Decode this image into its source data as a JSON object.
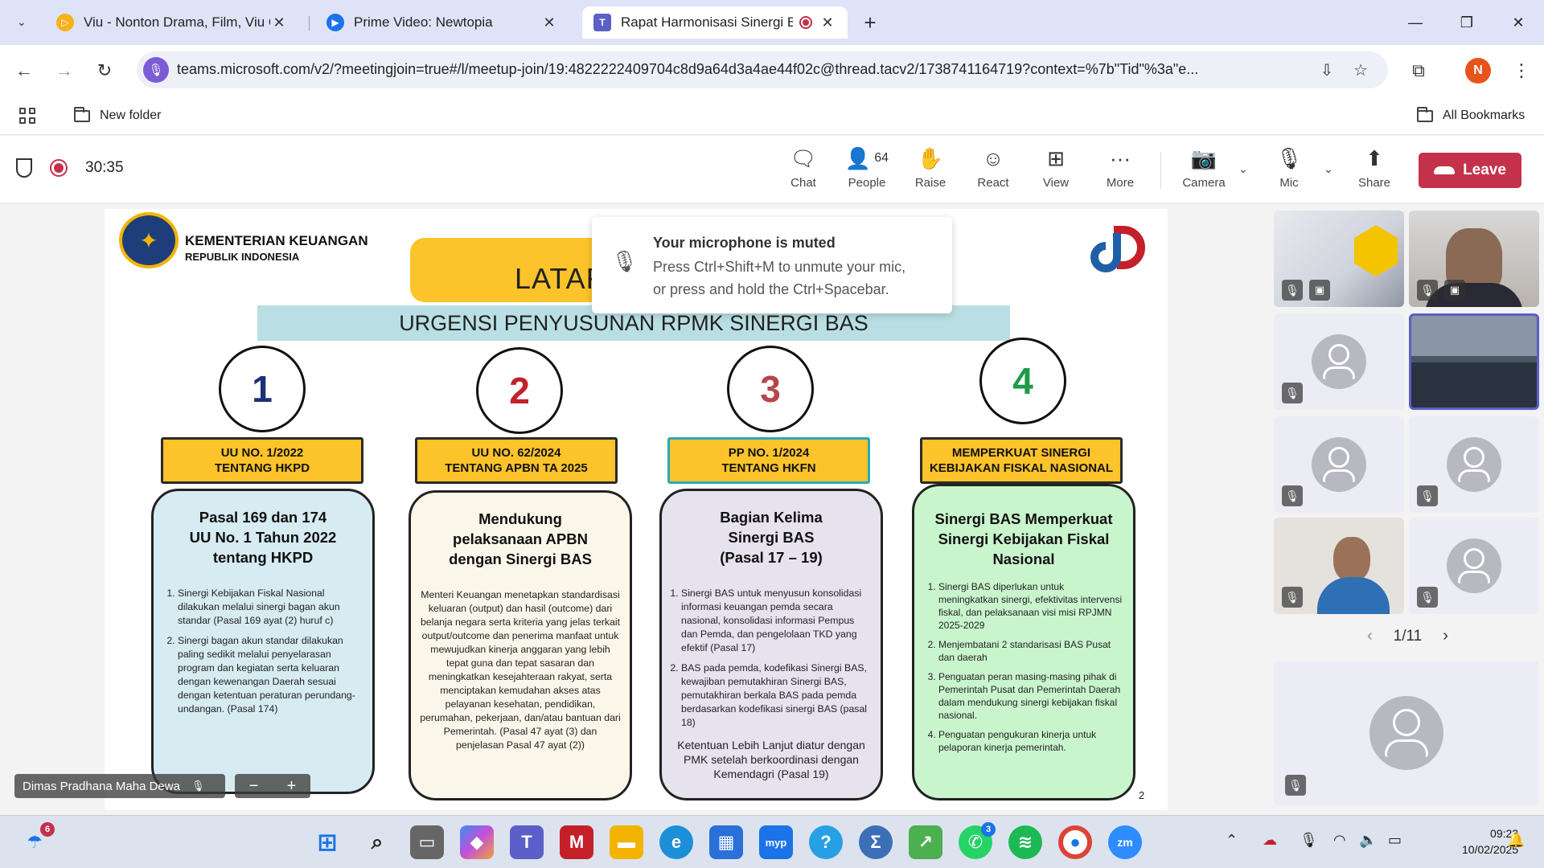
{
  "browser": {
    "tabs": [
      {
        "title": "Viu - Nonton Drama, Film, Viu O",
        "icon": "viu-icon",
        "color": "#f5b21a"
      },
      {
        "title": "Prime Video: Newtopia",
        "icon": "prime-video-icon",
        "color": "#1a73e8"
      },
      {
        "title": "Rapat Harmonisasi Sinergi B",
        "icon": "teams-icon",
        "color": "#5b5fc7"
      }
    ],
    "url": "teams.microsoft.com/v2/?meetingjoin=true#/l/meetup-join/19:4822222409704c8d9a64d3a4ae44f02c@thread.tacv2/1738741164719?context=%7b\"Tid\"%3a\"e...",
    "bookmarks": {
      "folder": "New folder",
      "all": "All Bookmarks"
    },
    "profile_initial": "N"
  },
  "teams": {
    "timer": "30:35",
    "buttons": {
      "chat": "Chat",
      "people": "People",
      "people_count": "64",
      "raise": "Raise",
      "react": "React",
      "view": "View",
      "more": "More",
      "camera": "Camera",
      "mic": "Mic",
      "share": "Share",
      "leave": "Leave"
    },
    "toast": {
      "title": "Your microphone is muted",
      "line1": "Press Ctrl+Shift+M to unmute your mic,",
      "line2": "or press and hold the Ctrl+Spacebar."
    },
    "presenter": "Dimas Pradhana Maha Dewa",
    "zoom": {
      "minus": "−",
      "plus": "+"
    },
    "pager": "1/11"
  },
  "slide": {
    "org_line1": "KEMENTERIAN KEUANGAN",
    "org_line2": "REPUBLIK INDONESIA",
    "header": "LATAR",
    "subheader": "URGENSI PENYUSUNAN RPMK SINERGI BAS",
    "page": "2",
    "columns": [
      {
        "num": "1",
        "num_color": "#1d2f7a",
        "label_bg": "#fcc32a",
        "card_bg": "#d6ebf2",
        "label1": "UU NO. 1/2022",
        "label2": "TENTANG HKPD",
        "title1": "Pasal 169 dan 174",
        "title2": "UU No. 1 Tahun 2022",
        "title3": "tentang HKPD",
        "items": [
          "Sinergi Kebijakan Fiskal Nasional dilakukan melalui sinergi bagan akun standar (Pasal 169 ayat (2) huruf c)",
          "Sinergi bagan akun standar dilakukan paling sedikit melalui penyelarasan program dan kegiatan serta keluaran dengan kewenangan Daerah sesuai dengan ketentuan peraturan perundang-undangan. (Pasal 174)"
        ]
      },
      {
        "num": "2",
        "num_color": "#c4202a",
        "label_bg": "#fcc32a",
        "card_bg": "#fbf6ea",
        "label1": "UU NO. 62/2024",
        "label2": "TENTANG APBN TA 2025",
        "title1": "Mendukung",
        "title2": "pelaksanaan APBN",
        "title3": "dengan Sinergi BAS",
        "body": "Menteri Keuangan menetapkan standardisasi keluaran (output) dan hasil (outcome) dari belanja negara serta kriteria yang jelas terkait output/outcome dan penerima manfaat untuk mewujudkan kinerja anggaran yang lebih tepat guna dan tepat sasaran dan meningkatkan kesejahteraan rakyat, serta menciptakan kemudahan akses atas pelayanan kesehatan, pendidikan, perumahan, pekerjaan, dan/atau bantuan dari Pemerintah. (Pasal 47 ayat (3) dan penjelasan Pasal 47 ayat (2))"
      },
      {
        "num": "3",
        "num_color": "#b5474a",
        "label_bg": "#fcc32a",
        "card_bg": "#e6e2ee",
        "label1": "PP NO. 1/2024",
        "label2": "TENTANG HKFN",
        "title1": "Bagian Kelima",
        "title2": "Sinergi BAS",
        "title3": "(Pasal 17 – 19)",
        "items": [
          "Sinergi BAS untuk menyusun konsolidasi informasi keuangan pemda secara nasional, konsolidasi informasi Pempus dan Pemda, dan pengelolaan TKD yang efektif (Pasal 17)",
          "BAS pada pemda, kodefikasi Sinergi BAS, kewajiban pemutakhiran Sinergi BAS, pemutakhiran berkala BAS pada pemda berdasarkan kodefikasi sinergi BAS (pasal 18)"
        ],
        "foot": "Ketentuan Lebih Lanjut diatur dengan PMK setelah berkoordinasi dengan Kemendagri (Pasal 19)"
      },
      {
        "num": "4",
        "num_color": "#1f9a4a",
        "label_bg": "#fcc32a",
        "card_bg": "#c9f5cd",
        "label1": "MEMPERKUAT SINERGI",
        "label2": "KEBIJAKAN FISKAL NASIONAL",
        "title1": "Sinergi BAS Memperkuat",
        "title2": "Sinergi Kebijakan Fiskal",
        "title3": "Nasional",
        "items": [
          "Sinergi BAS diperlukan untuk meningkatkan sinergi, efektivitas intervensi fiskal, dan pelaksanaan visi misi RPJMN 2025-2029",
          "Menjembatani 2 standarisasi BAS Pusat dan daerah",
          "Penguatan peran masing-masing pihak di Pemerintah Pusat dan Pemerintah Daerah dalam mendukung sinergi kebijakan fiskal nasional.",
          "Penguatan pengukuran kinerja untuk pelaporan kinerja pemerintah."
        ]
      }
    ]
  },
  "taskbar": {
    "weather_badge": "6",
    "whatsapp_badge": "3",
    "time": "09:23",
    "date": "10/02/2025"
  }
}
